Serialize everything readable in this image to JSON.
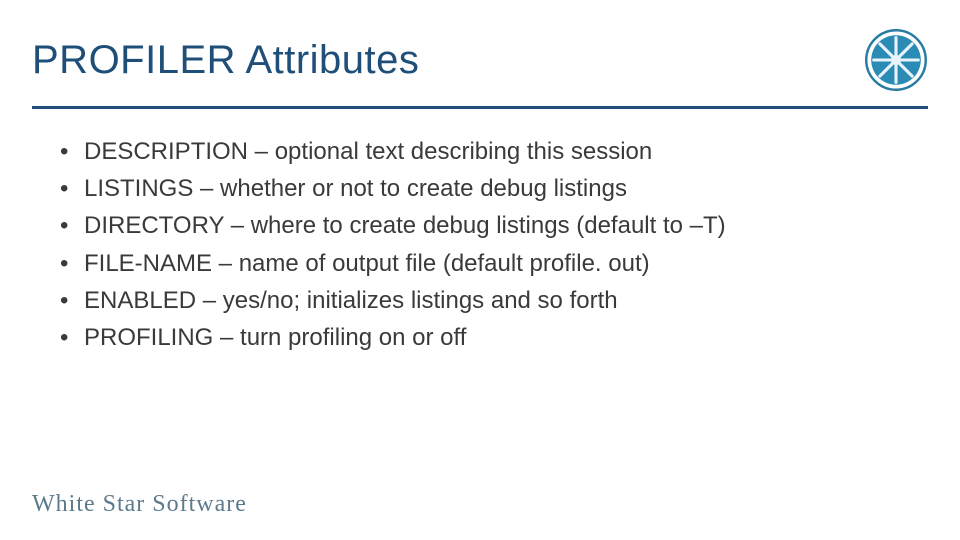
{
  "slide": {
    "title": "PROFILER Attributes",
    "bullets": [
      "DESCRIPTION – optional text describing this session",
      "LISTINGS – whether or not to create debug listings",
      "DIRECTORY – where to create debug listings (default to –T)",
      "FILE-NAME – name of output file (default profile. out)",
      "ENABLED – yes/no; initializes listings and so forth",
      "PROFILING – turn profiling on or off"
    ],
    "footer": "White Star Software"
  }
}
